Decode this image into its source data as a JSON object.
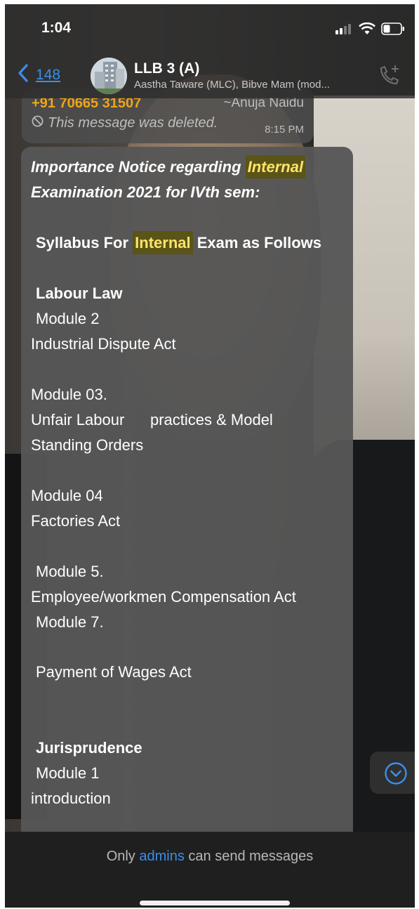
{
  "status_bar": {
    "time": "1:04"
  },
  "header": {
    "back_count": "148",
    "chat_title": "LLB 3 (A)",
    "participants": "Aastha Taware (MLC), Bibve Mam (mod..."
  },
  "deleted_message": {
    "sender_phone": "+91 70665 31507",
    "sender_name": "~Anuja Naidu",
    "text": "This message was deleted.",
    "time": "8:15 PM"
  },
  "notice": {
    "title_1_pre": "Importance Notice regarding ",
    "title_1_hl": "Internal",
    "title_2": "Examination 2021 for IVth sem:",
    "syllabus_pre": "Syllabus For ",
    "syllabus_hl": "Internal",
    "syllabus_post": " Exam as Follows",
    "labour_law": "Labour Law",
    "m2": "Module 2",
    "m2_desc": "Industrial Dispute Act",
    "m3": "Module 03.",
    "m3_desc_1": "Unfair Labour      practices & Model",
    "m3_desc_2": "Standing Orders",
    "m4": "Module 04",
    "m4_desc": "Factories Act",
    "m5": "Module 5.",
    "m5_desc": "Employee/workmen Compensation Act",
    "m7": "Module 7.",
    "m7_desc": "Payment of Wages Act",
    "jurisprudence": "Jurisprudence",
    "j1": "Module 1",
    "j1_desc": "introduction"
  },
  "footer": {
    "note_pre": "Only ",
    "note_link": "admins",
    "note_post": " can send messages"
  },
  "colors": {
    "accent": "#3b8eea",
    "sender": "#f0a419",
    "highlight": "#5a5416"
  },
  "icons": [
    "signal-icon",
    "wifi-icon",
    "battery-icon",
    "back-chevron-icon",
    "add-call-icon",
    "blocked-icon",
    "chevron-down-icon"
  ]
}
